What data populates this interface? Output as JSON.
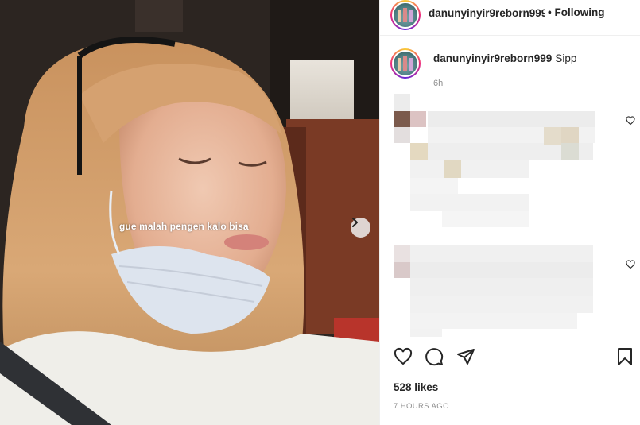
{
  "media": {
    "caption": "gue malah pengen kalo bisa",
    "next_icon": "chevron-right-icon"
  },
  "header": {
    "username": "danunyinyir9reborn999",
    "separator": "•",
    "following_label": "Following"
  },
  "post_caption": {
    "username": "danunyinyir9reborn999",
    "text": "Sipp",
    "time": "6h"
  },
  "colors": {
    "text": "#262626",
    "muted": "#8e8e8e",
    "border": "#efefef"
  },
  "actions": {
    "like_icon": "heart-icon",
    "comment_icon": "comment-icon",
    "share_icon": "share-icon",
    "save_icon": "bookmark-icon"
  },
  "stats": {
    "likes": "528 likes",
    "posted": "7 HOURS AGO"
  }
}
